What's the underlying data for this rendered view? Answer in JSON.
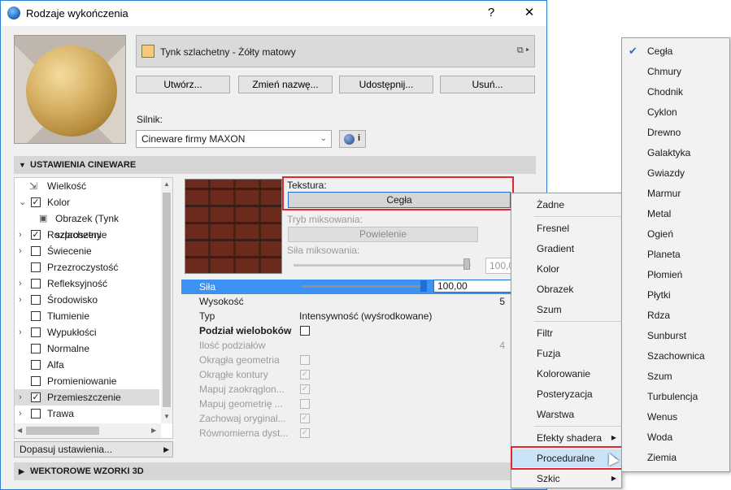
{
  "window": {
    "title": "Rodzaje wykończenia",
    "help": "?",
    "close": "✕"
  },
  "material": {
    "name": "Tynk szlachetny - Żółty matowy",
    "swatch_color": "#f7c97a",
    "menu_icon": "▸"
  },
  "buttons": {
    "create": "Utwórz...",
    "rename": "Zmień nazwę...",
    "share": "Udostępnij...",
    "delete": "Usuń..."
  },
  "engine": {
    "label": "Silnik:",
    "value": "Cineware firmy MAXON",
    "info": "i"
  },
  "sections": {
    "cineware": "USTAWIENIA CINEWARE",
    "vector": "WEKTOROWE WZORKI 3D"
  },
  "tree": [
    {
      "label": "Wielkość",
      "check": "",
      "toggle": ""
    },
    {
      "label": "Kolor",
      "check": "✓",
      "toggle": "⌄"
    },
    {
      "label": "Obrazek (Tynk szlachetny",
      "check": "",
      "toggle": ""
    },
    {
      "label": "Rozproszenie",
      "check": "✓",
      "toggle": "›"
    },
    {
      "label": "Świecenie",
      "check": "",
      "toggle": "›"
    },
    {
      "label": "Przezroczystość",
      "check": "",
      "toggle": ""
    },
    {
      "label": "Refleksyjność",
      "check": "",
      "toggle": "›"
    },
    {
      "label": "Środowisko",
      "check": "",
      "toggle": "›"
    },
    {
      "label": "Tłumienie",
      "check": "",
      "toggle": ""
    },
    {
      "label": "Wypukłości",
      "check": "",
      "toggle": "›"
    },
    {
      "label": "Normalne",
      "check": "",
      "toggle": ""
    },
    {
      "label": "Alfa",
      "check": "",
      "toggle": ""
    },
    {
      "label": "Promieniowanie",
      "check": "",
      "toggle": ""
    },
    {
      "label": "Przemieszczenie",
      "check": "✓",
      "toggle": "›"
    },
    {
      "label": "Trawa",
      "check": "",
      "toggle": "›"
    }
  ],
  "adjust_button": "Dopasuj ustawienia...",
  "texture": {
    "label": "Tekstura:",
    "value": "Cegła"
  },
  "mix": {
    "mode_label": "Tryb miksowania:",
    "mode_value": "Powielenie",
    "strength_label": "Siła miksowania:",
    "strength_value": "100,0"
  },
  "properties": [
    {
      "name": "Siła",
      "value": "100,00",
      "kind": "slider"
    },
    {
      "name": "Wysokość",
      "value": "5",
      "kind": "right"
    },
    {
      "name": "Typ",
      "value": "Intensywność (wyśrodkowane)",
      "kind": "text"
    },
    {
      "name": "Podział wieloboków",
      "value": "",
      "kind": "checkbox"
    },
    {
      "name": "Ilość podziałów",
      "value": "4",
      "kind": "right-dis"
    },
    {
      "name": "Okrągła geometria",
      "value": "",
      "kind": "cb-dis"
    },
    {
      "name": "Okrągłe kontury",
      "value": "✓",
      "kind": "cb-dis"
    },
    {
      "name": "Mapuj zaokrąglon...",
      "value": "✓",
      "kind": "cb-dis"
    },
    {
      "name": "Mapuj geometrię ...",
      "value": "",
      "kind": "cb-dis"
    },
    {
      "name": "Zachowaj oryginal...",
      "value": "✓",
      "kind": "cb-dis"
    },
    {
      "name": "Równomierna dyst...",
      "value": "✓",
      "kind": "cb-dis"
    }
  ],
  "context_menu": [
    {
      "label": "Żadne"
    },
    {
      "label": "Fresnel"
    },
    {
      "label": "Gradient"
    },
    {
      "label": "Kolor"
    },
    {
      "label": "Obrazek"
    },
    {
      "label": "Szum"
    },
    {
      "label": "Filtr"
    },
    {
      "label": "Fuzja"
    },
    {
      "label": "Kolorowanie"
    },
    {
      "label": "Posteryzacja"
    },
    {
      "label": "Warstwa"
    },
    {
      "label": "Efekty shadera",
      "sub": "▶"
    },
    {
      "label": "Proceduralne",
      "sub": "▶"
    },
    {
      "label": "Szkic",
      "sub": "▶"
    }
  ],
  "sub_menu": [
    {
      "label": "Cegła",
      "check": "✔"
    },
    {
      "label": "Chmury"
    },
    {
      "label": "Chodnik"
    },
    {
      "label": "Cyklon"
    },
    {
      "label": "Drewno"
    },
    {
      "label": "Galaktyka"
    },
    {
      "label": "Gwiazdy"
    },
    {
      "label": "Marmur"
    },
    {
      "label": "Metal"
    },
    {
      "label": "Ogień"
    },
    {
      "label": "Planeta"
    },
    {
      "label": "Płomień"
    },
    {
      "label": "Płytki"
    },
    {
      "label": "Rdza"
    },
    {
      "label": "Sunburst"
    },
    {
      "label": "Szachownica"
    },
    {
      "label": "Szum"
    },
    {
      "label": "Turbulencja"
    },
    {
      "label": "Wenus"
    },
    {
      "label": "Woda"
    },
    {
      "label": "Ziemia"
    }
  ],
  "colors": {
    "accent": "#3d91f0",
    "highlight_box": "#e3262f",
    "menu_hover": "#cbe3f7"
  }
}
